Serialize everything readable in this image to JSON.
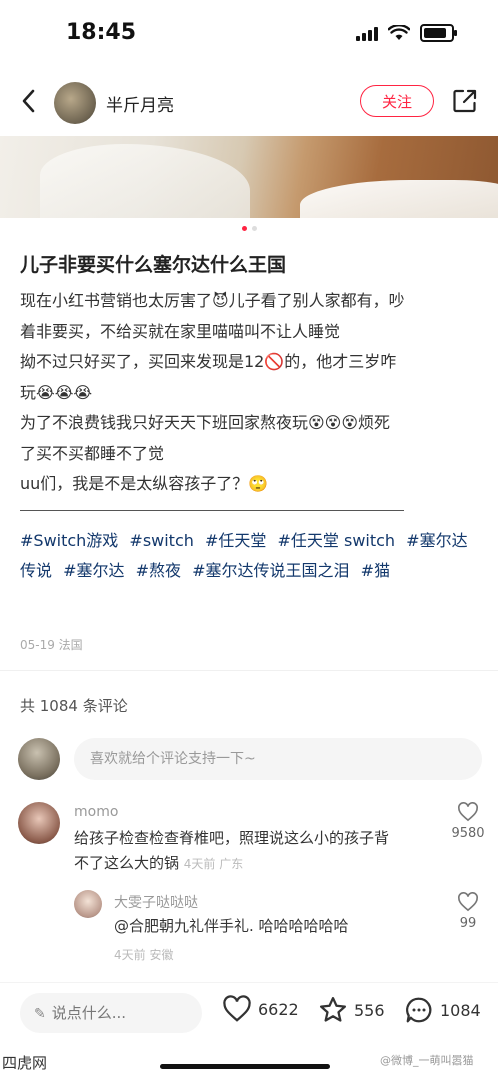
{
  "status": {
    "time": "18:45",
    "battery_level": 0.85
  },
  "nav": {
    "author": "半斤月亮",
    "follow_label": "关注"
  },
  "post": {
    "title": "儿子非要买什么塞尔达什么王国",
    "body_lines": [
      "现在小红书营销也太厉害了😈儿子看了别人家都有，吵",
      "着非要买，不给买就在家里喵喵叫不让人睡觉",
      "拗不过只好买了，买回来发现是12🚫的，他才三岁咋",
      "玩😭😭😭",
      "为了不浪费钱我只好天天下班回家熬夜玩😵😵😵烦死",
      "了买不买都睡不了觉",
      "uu们，我是不是太纵容孩子了？🙄"
    ],
    "hashtags": [
      "#Switch游戏",
      "#switch",
      "#任天堂",
      "#任天堂 switch",
      "#塞尔达传说",
      "#塞尔达",
      "#熬夜",
      "#塞尔达传说王国之泪",
      "#猫"
    ],
    "meta": "05-19 法国",
    "image_page": 1,
    "image_count": 2
  },
  "comments": {
    "count_text": "共 1084 条评论",
    "input_placeholder": "喜欢就给个评论支持一下~",
    "items": [
      {
        "user": "momo",
        "text_line1": "给孩子检查检查脊椎吧，照理说这么小的孩子背",
        "text_line2": "不了这么大的锅",
        "meta": "4天前 广东",
        "likes": "9580"
      },
      {
        "user": "大雯子哒哒哒",
        "text": "@合肥朝九礼伴手礼. 哈哈哈哈哈哈",
        "meta": "4天前 安徽",
        "likes": "99"
      }
    ]
  },
  "bottom": {
    "say_placeholder": "说点什么...",
    "like_count": "6622",
    "star_count": "556",
    "comment_count": "1084"
  },
  "watermark": {
    "left": "四虎网",
    "right": "@微博_一萌叫嚣猫"
  }
}
